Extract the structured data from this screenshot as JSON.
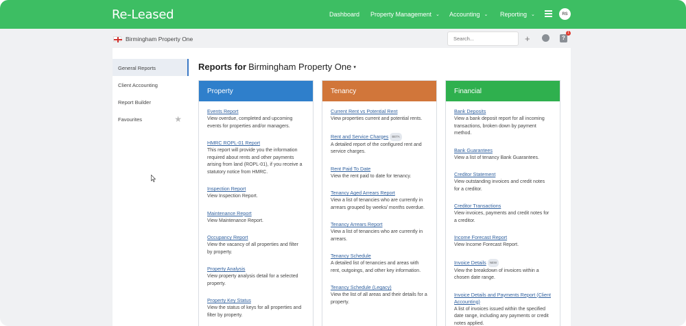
{
  "app": {
    "logo": "Re-Leased"
  },
  "nav": {
    "dashboard": "Dashboard",
    "property_management": "Property Management",
    "accounting": "Accounting",
    "reporting": "Reporting",
    "chevron": "⌄",
    "avatar_initials": "RS"
  },
  "subbar": {
    "property_name": "Birmingham Property One",
    "search_placeholder": "Search...",
    "add_symbol": "+",
    "help_symbol": "?",
    "notification_count": "1"
  },
  "sidebar": {
    "items": [
      {
        "label": "General Reports"
      },
      {
        "label": "Client Accounting"
      },
      {
        "label": "Report Builder"
      },
      {
        "label": "Favourites"
      }
    ],
    "favourites_star": "★"
  },
  "main": {
    "title": "Reports for",
    "property": "Birmingham Property One",
    "caret": "▾"
  },
  "columns": {
    "property": {
      "title": "Property",
      "color": "#2f7fcb",
      "items": [
        {
          "link": "Events Report",
          "desc": "View overdue, completed and upcoming events for properties and/or managers."
        },
        {
          "link": "HMRC ROPL-01 Report",
          "desc": "This report will provide you the information required about rents and other payments arising from land (ROPL-01), if you receive a statutory notice from HMRC."
        },
        {
          "link": "Inspection Report",
          "desc": "View Inspection Report."
        },
        {
          "link": "Maintenance Report",
          "desc": "View Maintenance Report."
        },
        {
          "link": "Occupancy Report",
          "desc": "View the vacancy of all properties and filter by property."
        },
        {
          "link": "Property Analysis",
          "desc": "View property analysis detail for a selected property."
        },
        {
          "link": "Property Key Status",
          "desc": "View the status of keys for all properties and filter by property."
        }
      ]
    },
    "tenancy": {
      "title": "Tenancy",
      "color": "#d1763a",
      "items": [
        {
          "link": "Current Rent vs Potential Rent",
          "desc": "View properties current and potential rents."
        },
        {
          "link": "Rent and Service Charges",
          "tag": "BETA",
          "desc": "A detailed report of the configured rent and service charges."
        },
        {
          "link": "Rent Paid To Date",
          "desc": "View the rent paid to date for tenancy."
        },
        {
          "link": "Tenancy Aged Arrears Report",
          "desc": "View a list of tenancies who are currently in arrears grouped by weeks/ months overdue."
        },
        {
          "link": "Tenancy Arrears Report",
          "desc": "View a list of tenancies who are currently in arrears."
        },
        {
          "link": "Tenancy Schedule",
          "desc": "A detailed list of tenancies and areas with rent, outgoings, and other key information."
        },
        {
          "link": "Tenancy Schedule (Legacy)",
          "desc": "View the list of all areas and their details for a property."
        }
      ]
    },
    "financial": {
      "title": "Financial",
      "color": "#2fb04e",
      "items": [
        {
          "link": "Bank Deposits",
          "desc": "View a bank deposit report for all incoming transactions, broken down by payment method."
        },
        {
          "link": "Bank Guarantees",
          "desc": "View a list of tenancy Bank Guarantees."
        },
        {
          "link": "Creditor Statement",
          "desc": "View outstanding invoices and credit notes for a creditor."
        },
        {
          "link": "Creditor Transactions",
          "desc": "View invoices, payments and credit notes for a creditor."
        },
        {
          "link": "Income Forecast Report",
          "desc": "View Income Forecast Report."
        },
        {
          "link": "Invoice Details",
          "tag": "NEW",
          "desc": "View the breakdown of invoices within a chosen date range."
        },
        {
          "link": "Invoice Details and Payments Report (Client Accounting)",
          "desc": "A list of invoices issued within the specified date range, including any payments or credit notes applied."
        }
      ]
    }
  }
}
